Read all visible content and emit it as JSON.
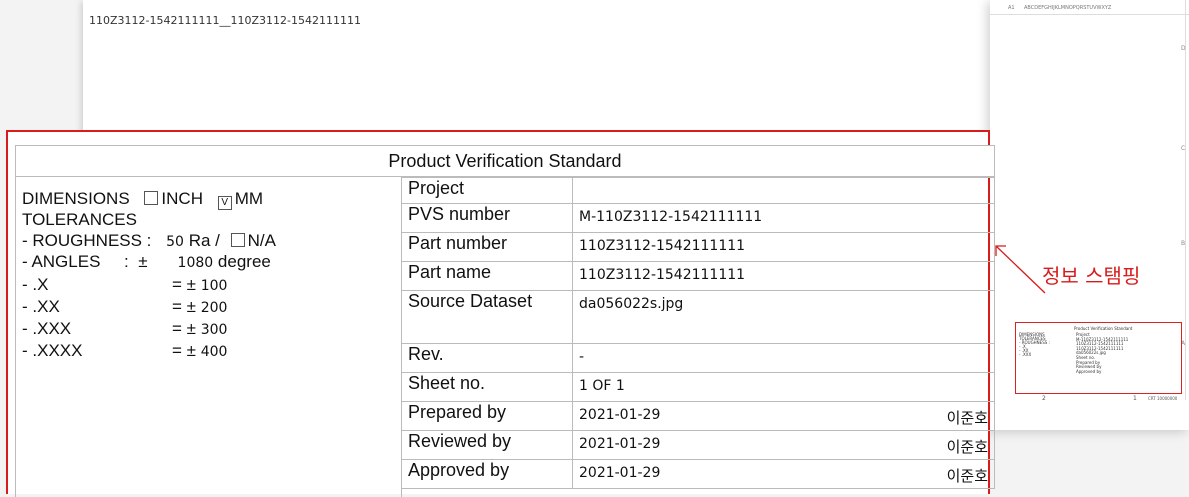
{
  "sheet": {
    "title": "110Z3112-1542111111__110Z3112-1542111111",
    "topbar": {
      "cell": "A1",
      "path": "ABCDEFGHIJKLMNOPQRSTUVWXYZ"
    },
    "edge_letters": [
      "D",
      "C",
      "B",
      "A"
    ],
    "thumb_numbers": [
      "2",
      "1",
      "CRT 10000000"
    ]
  },
  "callout": {
    "label": "정보 스탬핑"
  },
  "stamp": {
    "title": "Product Verification Standard",
    "dimensions_label": "DIMENSIONS",
    "inch_label": "INCH",
    "inch_checked": false,
    "mm_label": "MM",
    "mm_checked": true,
    "tolerances_label": "TOLERANCES",
    "roughness_label": "- ROUGHNESS :",
    "roughness_value": "50",
    "roughness_unit": "Ra /",
    "na_label": "N/A",
    "angles_label": "- ANGLES     :  ±",
    "angles_value": "1080",
    "angles_unit": "degree",
    "tolerance_rows": [
      {
        "label": "- .X",
        "sign": "= ±",
        "value": "100"
      },
      {
        "label": "- .XX",
        "sign": "= ±",
        "value": "200"
      },
      {
        "label": "- .XXX",
        "sign": "= ±",
        "value": "300"
      },
      {
        "label": "- .XXXX",
        "sign": "= ±",
        "value": "400"
      }
    ],
    "rows": [
      {
        "label": "Project",
        "value": "",
        "sign": ""
      },
      {
        "label": "PVS number",
        "value": "M-110Z3112-1542111111",
        "sign": ""
      },
      {
        "label": "Part number",
        "value": "110Z3112-1542111111",
        "sign": ""
      },
      {
        "label": "Part name",
        "value": "110Z3112-1542111111",
        "sign": ""
      },
      {
        "label": "Source Dataset",
        "value": "da056022s.jpg",
        "sign": ""
      },
      {
        "label": "Rev.",
        "value": "-",
        "sign": ""
      },
      {
        "label": "Sheet no.",
        "value": "1 OF 1",
        "sign": ""
      },
      {
        "label": "Prepared by",
        "value": "2021-01-29",
        "sign": "이준호"
      },
      {
        "label": "Reviewed by",
        "value": "2021-01-29",
        "sign": "이준호"
      },
      {
        "label": "Approved by",
        "value": "2021-01-29",
        "sign": "이준호"
      }
    ]
  }
}
